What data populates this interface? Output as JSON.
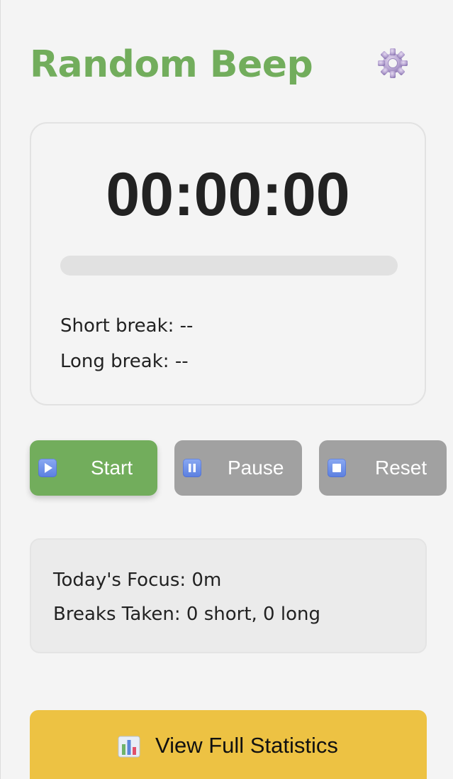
{
  "app": {
    "title": "Random Beep"
  },
  "header": {
    "settings_icon": "gear-icon"
  },
  "timer": {
    "display": "00:00:00",
    "progress": 0,
    "short_break": "Short break: --",
    "long_break": "Long break: --"
  },
  "controls": {
    "start_label": "Start",
    "start_icon": "play-icon",
    "pause_label": "Pause",
    "pause_icon": "pause-icon",
    "reset_label": "Reset",
    "reset_icon": "stop-icon"
  },
  "stats": {
    "focus": "Today's Focus: 0m",
    "breaks": "Breaks Taken: 0 short, 0 long"
  },
  "footer": {
    "view_stats_label": "View Full Statistics",
    "view_stats_icon": "bar-chart-icon"
  },
  "colors": {
    "accent_green": "#72ad5c",
    "button_gray": "#a1a1a1",
    "stats_yellow": "#edc243",
    "background": "#f4f4f4"
  }
}
